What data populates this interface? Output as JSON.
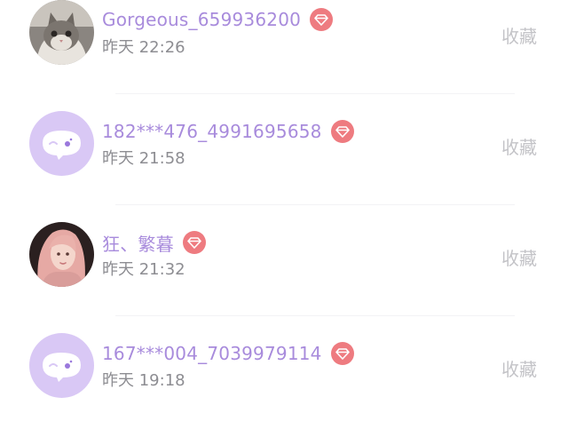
{
  "list": {
    "items": [
      {
        "name": "Gorgeous_659936200",
        "time": "昨天 22:26",
        "action_label": "收藏",
        "avatar": "cat-photo",
        "badge_icon": "diamond-icon"
      },
      {
        "name": "182***476_4991695658",
        "time": "昨天 21:58",
        "action_label": "收藏",
        "avatar": "default-chat-avatar",
        "badge_icon": "diamond-icon"
      },
      {
        "name": "狂、繁暮",
        "time": "昨天 21:32",
        "action_label": "收藏",
        "avatar": "girl-photo",
        "badge_icon": "diamond-icon"
      },
      {
        "name": "167***004_7039979114",
        "time": "昨天 19:18",
        "action_label": "收藏",
        "avatar": "default-chat-avatar",
        "badge_icon": "diamond-icon"
      }
    ]
  },
  "colors": {
    "name": "#a88bdc",
    "badge": "#ee7b80",
    "time": "#8d8d92",
    "action": "#c3c3c7",
    "avatar_default_bg": "#d9c8f5"
  }
}
